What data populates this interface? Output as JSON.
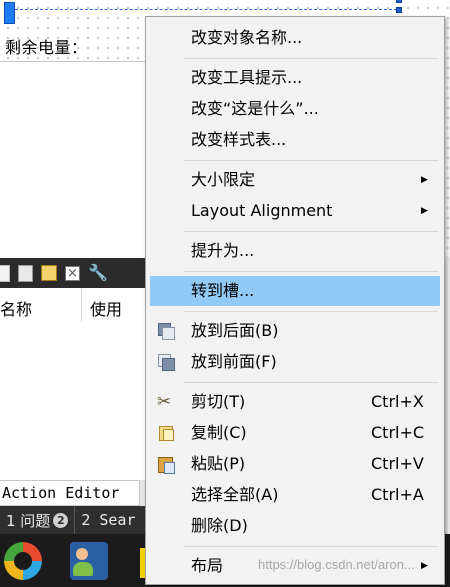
{
  "form": {
    "remaining_label": "剩余电量："
  },
  "table": {
    "col_name": "名称",
    "col_use": "使用"
  },
  "action_tab": {
    "label": "Action Editor"
  },
  "statusbar": {
    "issues_label": "1 问题",
    "issues_count": "2",
    "search_label": "2 Sear"
  },
  "menu": {
    "change_object_name": "改变对象名称...",
    "change_tooltip": "改变工具提示...",
    "change_whats_this": "改变“这是什么”...",
    "change_stylesheet": "改变样式表...",
    "size_constraints": "大小限定",
    "layout_alignment": "Layout Alignment",
    "promote_to": "提升为...",
    "go_to_slot": "转到槽...",
    "send_to_back": "放到后面(B)",
    "bring_to_front": "放到前面(F)",
    "cut": "剪切(T)",
    "cut_shortcut": "Ctrl+X",
    "copy": "复制(C)",
    "copy_shortcut": "Ctrl+C",
    "paste": "粘贴(P)",
    "paste_shortcut": "Ctrl+V",
    "select_all": "选择全部(A)",
    "select_all_shortcut": "Ctrl+A",
    "delete": "删除(D)",
    "layout": "布局",
    "submenu_arrow": "▶"
  },
  "watermark": "https://blog.csdn.net/aron..."
}
